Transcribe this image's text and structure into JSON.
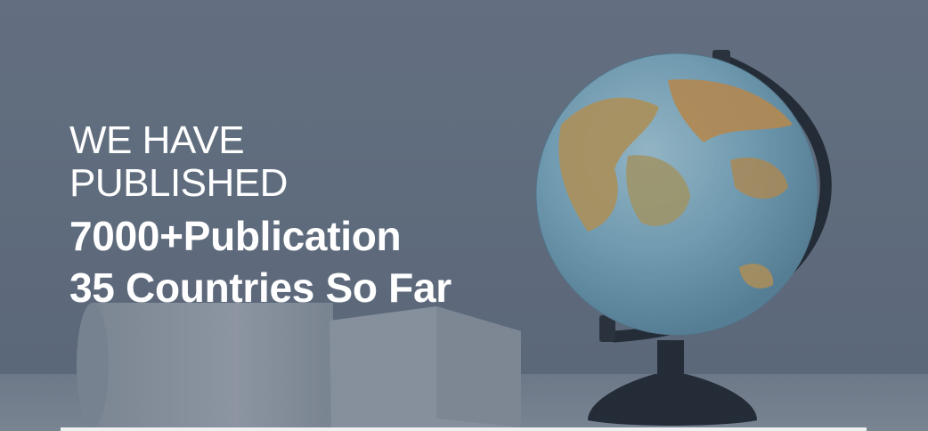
{
  "hero": {
    "line1": "WE HAVE",
    "line2": "PUBLISHED",
    "line3": "7000+Publication",
    "line4": "35 Countries So Far"
  },
  "colors": {
    "overlay": "#5f6d7e",
    "text": "#ffffff",
    "globe_ocean": "#7fb3c9",
    "globe_land": "#c9a15a",
    "stand": "#232a33"
  },
  "icons": [
    "globe-image",
    "white-cylinder",
    "white-block"
  ]
}
